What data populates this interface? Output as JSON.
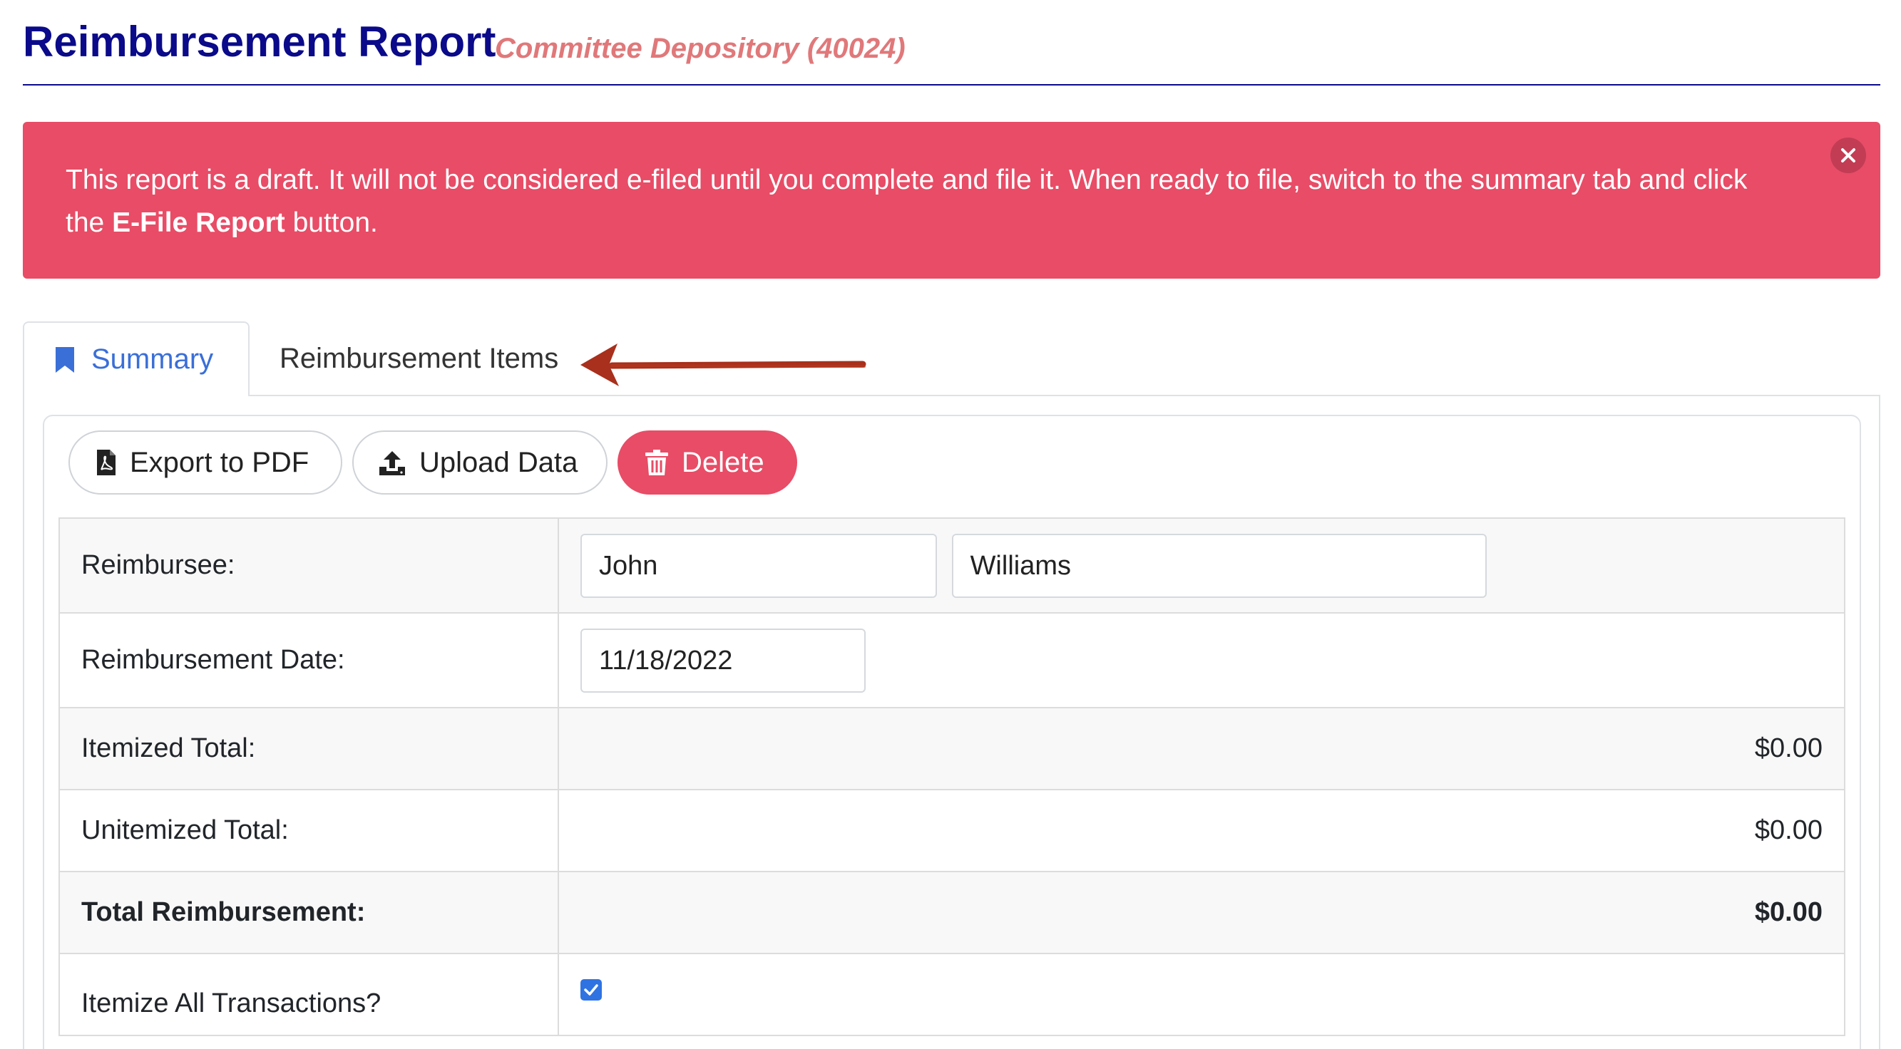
{
  "header": {
    "title": "Reimbursement Report",
    "subtitle": "Committee Depository (40024)"
  },
  "alert": {
    "text_before": "This report is a draft. It will not be considered e-filed until you complete and file it. When ready to file, switch to the summary tab and click the ",
    "bold_text": "E-File Report",
    "text_after": " button.",
    "close_icon": "close-icon"
  },
  "tabs": [
    {
      "label": "Summary",
      "icon": "bookmark-icon",
      "active": true
    },
    {
      "label": "Reimbursement Items",
      "active": false
    }
  ],
  "toolbar": {
    "export_label": "Export to PDF",
    "upload_label": "Upload Data",
    "delete_label": "Delete"
  },
  "form": {
    "reimbursee_label": "Reimbursee:",
    "first_name": "John",
    "last_name": "Williams",
    "date_label": "Reimbursement Date:",
    "date_value": "11/18/2022",
    "itemized_label": "Itemized Total:",
    "itemized_value": "$0.00",
    "unitemized_label": "Unitemized Total:",
    "unitemized_value": "$0.00",
    "total_label": "Total Reimbursement:",
    "total_value": "$0.00",
    "itemize_all_label": "Itemize All Transactions?",
    "itemize_all_checked": true
  },
  "colors": {
    "title": "#0a0a8a",
    "subtitle": "#e0787a",
    "alert_bg": "#e84c66",
    "active_tab": "#3a6fd8",
    "danger": "#e84c66",
    "annotation_arrow": "#a8301c"
  }
}
